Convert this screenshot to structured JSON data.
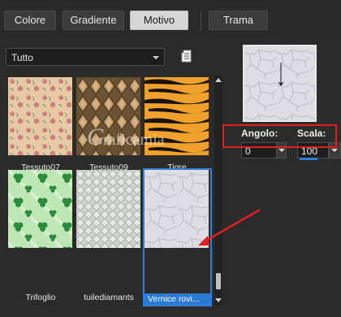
{
  "tabs": [
    {
      "label": "Colore",
      "active": false
    },
    {
      "label": "Gradiente",
      "active": false
    },
    {
      "label": "Motivo",
      "active": true
    },
    {
      "label": "Trama",
      "active": false
    }
  ],
  "category_select": {
    "value": "Tutto"
  },
  "patterns": [
    {
      "label": "Tessuto07",
      "icon": "floral-fabric-pattern"
    },
    {
      "label": "Tessuto09",
      "icon": "diamond-fabric-pattern"
    },
    {
      "label": "Tigre",
      "icon": "tiger-stripe-pattern"
    },
    {
      "label": "Trifoglio",
      "icon": "clover-pattern"
    },
    {
      "label": "tuilediamants",
      "icon": "diamond-tile-pattern"
    },
    {
      "label": "Vernice rovi...",
      "icon": "cracked-paint-pattern",
      "selected": true
    }
  ],
  "controls": {
    "angle_label": "Angolo:",
    "angle_value": "0",
    "scale_label": "Scala:",
    "scale_value": "100"
  },
  "watermark": {
    "text": "Graficamia"
  },
  "colors": {
    "accent": "#2f7fd6",
    "annotation": "#e02020",
    "panel": "#2b2b2b"
  }
}
